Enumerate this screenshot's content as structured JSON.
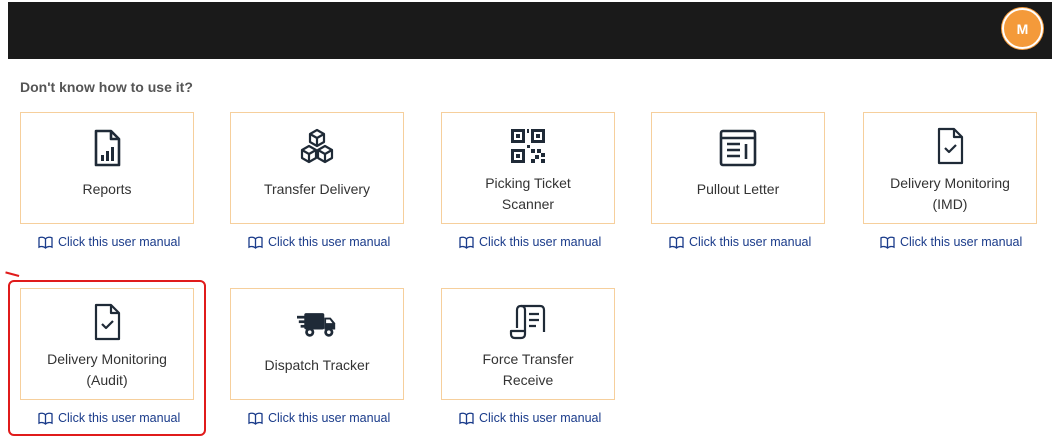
{
  "header": {
    "avatar_letter": "M"
  },
  "help_text": "Don't know how to use it?",
  "cards": [
    {
      "label": "Reports",
      "icon": "report-chart-icon",
      "manual": "Click this user manual"
    },
    {
      "label": "Transfer Delivery",
      "icon": "boxes-icon",
      "manual": "Click this user manual"
    },
    {
      "label": "Picking Ticket\nScanner",
      "icon": "qr-code-icon",
      "manual": "Click this user manual"
    },
    {
      "label": "Pullout Letter",
      "icon": "document-layout-icon",
      "manual": "Click this user manual"
    },
    {
      "label": "Delivery Monitoring\n(IMD)",
      "icon": "file-check-icon",
      "manual": "Click this user manual"
    },
    {
      "label": "Delivery Monitoring\n(Audit)",
      "icon": "file-check-icon",
      "manual": "Click this user manual"
    },
    {
      "label": "Dispatch Tracker",
      "icon": "truck-fast-icon",
      "manual": "Click this user manual"
    },
    {
      "label": "Force Transfer\nReceive",
      "icon": "scroll-receipt-icon",
      "manual": "Click this user manual"
    }
  ],
  "colors": {
    "card_border": "#f6cf9c",
    "link": "#1a3b8a",
    "avatar": "#f49a3a",
    "header": "#1a1a1a",
    "annotation": "#e01b1b"
  }
}
